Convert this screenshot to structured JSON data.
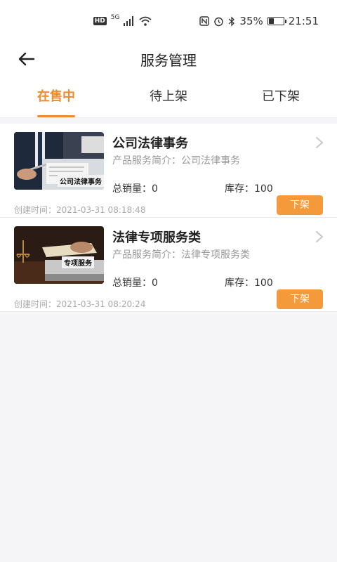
{
  "status_bar": {
    "hd": "HD",
    "network": "5G",
    "battery": "35%",
    "battery_level": 0.35,
    "time": "21:51"
  },
  "header": {
    "title": "服务管理"
  },
  "tabs": [
    {
      "label": "在售中",
      "active": true
    },
    {
      "label": "待上架",
      "active": false
    },
    {
      "label": "已下架",
      "active": false
    }
  ],
  "products": [
    {
      "name": "公司法律事务",
      "intro": "产品服务简介：公司法律事务",
      "sales": "总销量：0",
      "stock": "库存：100",
      "created": "创建时间：2021-03-31 08:18:48",
      "action": "下架",
      "thumb_label": "公司法律事务"
    },
    {
      "name": "法律专项服务类",
      "intro": "产品服务简介：法律专项服务类",
      "sales": "总销量：0",
      "stock": "库存：100",
      "created": "创建时间：2021-03-31 08:20:24",
      "action": "下架",
      "thumb_label": "专项服务"
    }
  ],
  "colors": {
    "accent": "#f08a2e",
    "button": "#f59a3a"
  }
}
